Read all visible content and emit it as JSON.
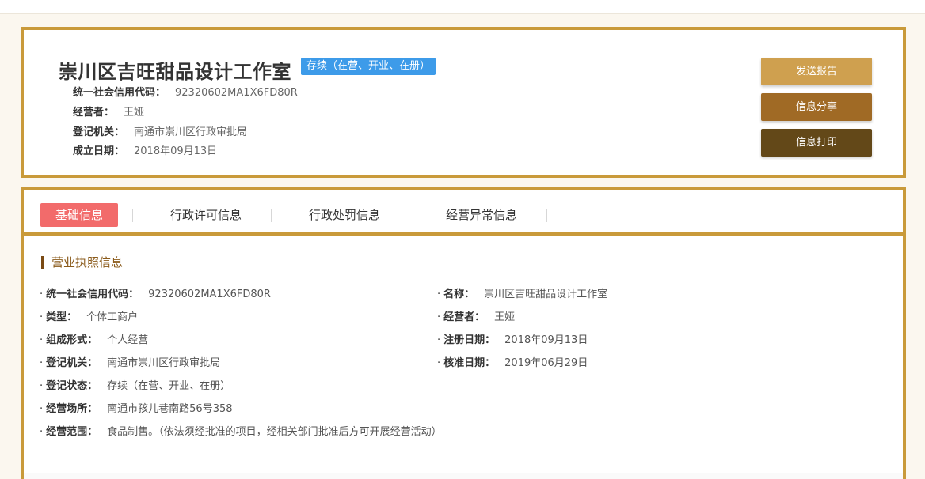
{
  "header": {
    "company_name": "崇川区吉旺甜品设计工作室",
    "status_badge": "存续（在营、开业、在册）",
    "rows": [
      {
        "label": "统一社会信用代码：",
        "value": "92320602MA1X6FD80R"
      },
      {
        "label": "经营者：",
        "value": "王娅"
      },
      {
        "label": "登记机关：",
        "value": "南通市崇川区行政审批局"
      },
      {
        "label": "成立日期：",
        "value": "2018年09月13日"
      }
    ],
    "buttons": {
      "send_report": "发送报告",
      "share_info": "信息分享",
      "print_info": "信息打印"
    }
  },
  "tabs": [
    {
      "label": "基础信息",
      "active": true
    },
    {
      "label": "行政许可信息",
      "active": false
    },
    {
      "label": "行政处罚信息",
      "active": false
    },
    {
      "label": "经营异常信息",
      "active": false
    }
  ],
  "section": {
    "title": "营业执照信息",
    "bullet": "·",
    "left_fields": [
      {
        "label": "统一社会信用代码：",
        "value": "92320602MA1X6FD80R"
      },
      {
        "label": "类型：",
        "value": "个体工商户"
      },
      {
        "label": "组成形式：",
        "value": "个人经营"
      },
      {
        "label": "登记机关：",
        "value": "南通市崇川区行政审批局"
      },
      {
        "label": "登记状态：",
        "value": "存续（在营、开业、在册）"
      },
      {
        "label": "经营场所：",
        "value": "南通市孩儿巷南路56号358"
      },
      {
        "label": "经营范围：",
        "value": "食品制售。（依法须经批准的项目，经相关部门批准后方可开展经营活动）"
      }
    ],
    "right_fields": [
      {
        "label": "名称：",
        "value": "崇川区吉旺甜品设计工作室"
      },
      {
        "label": "经营者：",
        "value": "王娅"
      },
      {
        "label": "注册日期：",
        "value": "2018年09月13日"
      },
      {
        "label": "核准日期：",
        "value": "2019年06月29日"
      }
    ]
  },
  "colors": {
    "border_gold": "#c99a3a",
    "badge_blue": "#3d9be9",
    "tab_active": "#f26b6b"
  }
}
